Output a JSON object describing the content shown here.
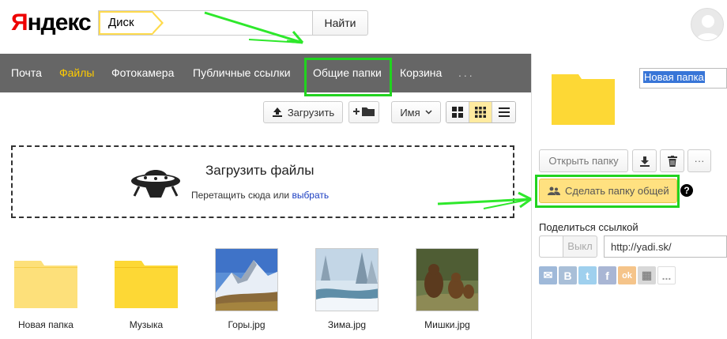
{
  "header": {
    "logo_first": "Я",
    "logo_rest": "ндекс",
    "service_tag": "Диск",
    "search_value": "",
    "find_label": "Найти"
  },
  "nav": {
    "items": [
      {
        "label": "Почта"
      },
      {
        "label": "Файлы",
        "active": true
      },
      {
        "label": "Фотокамера"
      },
      {
        "label": "Публичные ссылки"
      },
      {
        "label": "Общие папки"
      },
      {
        "label": "Корзина"
      },
      {
        "label": "..."
      }
    ]
  },
  "toolbar": {
    "upload_label": "Загрузить",
    "sort_label": "Имя",
    "view_modes": [
      "large-icons",
      "small-icons",
      "list"
    ],
    "active_view": "small-icons"
  },
  "dropzone": {
    "title": "Загрузить файлы",
    "subtitle_prefix": "Перетащить сюда или ",
    "subtitle_link": "выбрать"
  },
  "files": [
    {
      "name": "Новая папка",
      "type": "folder"
    },
    {
      "name": "Музыка",
      "type": "folder"
    },
    {
      "name": "Горы.jpg",
      "type": "image"
    },
    {
      "name": "Зима.jpg",
      "type": "image"
    },
    {
      "name": "Мишки.jpg",
      "type": "image"
    }
  ],
  "panel": {
    "folder_name": "Новая папка",
    "open_label": "Открыть папку",
    "share_folder_label": "Сделать папку общей",
    "help_symbol": "?",
    "share_link_title": "Поделиться ссылкой",
    "toggle_label": "Выкл",
    "link_value": "http://yadi.sk/",
    "social": [
      {
        "name": "mail-icon",
        "glyph": "✉",
        "color": "#9fb9d9"
      },
      {
        "name": "vk-icon",
        "glyph": "B",
        "color": "#a9bfd8"
      },
      {
        "name": "twitter-icon",
        "glyph": "t",
        "color": "#9fd0ee"
      },
      {
        "name": "facebook-icon",
        "glyph": "f",
        "color": "#a9b6d4"
      },
      {
        "name": "odnoklassniki-icon",
        "glyph": "ok",
        "color": "#f5c48a"
      },
      {
        "name": "qr-icon",
        "glyph": "▦",
        "color": "#d8d8d8"
      },
      {
        "name": "more-icon",
        "glyph": "...",
        "color": "#ffffff"
      }
    ]
  },
  "colors": {
    "accent_yellow": "#ffcc00",
    "nav_bg": "#666666",
    "highlight_green": "#21d31f",
    "folder_yellow": "#fdd835"
  }
}
